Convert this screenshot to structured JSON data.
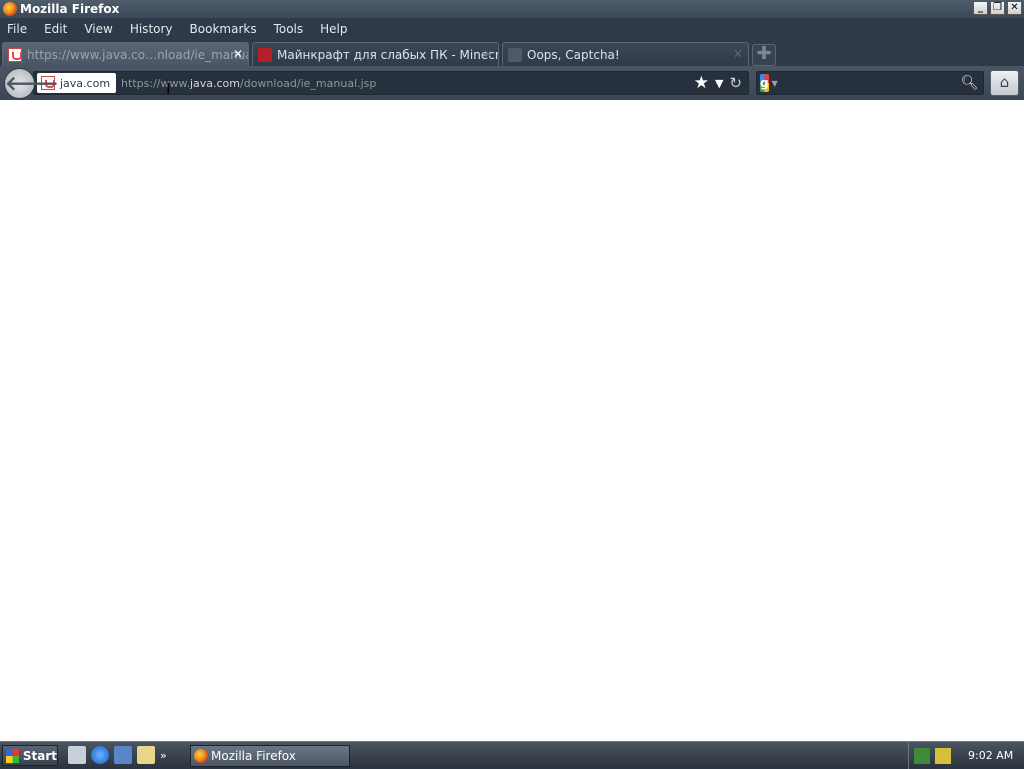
{
  "window": {
    "title": "Mozilla Firefox",
    "controls": {
      "minimize": "_",
      "restore": "❐",
      "close": "✕"
    }
  },
  "menubar": {
    "items": [
      {
        "label": "File"
      },
      {
        "label": "Edit"
      },
      {
        "label": "View"
      },
      {
        "label": "History"
      },
      {
        "label": "Bookmarks"
      },
      {
        "label": "Tools"
      },
      {
        "label": "Help"
      }
    ]
  },
  "tabs": [
    {
      "title": "https://www.java.co…nload/ie_manual.jsp",
      "icon": "java-icon",
      "active": true
    },
    {
      "title": "Майнкрафт для слабых ПК - Minecraft …",
      "icon": "minecraft-icon",
      "active": false
    },
    {
      "title": "Oops, Captcha!",
      "icon": "blank-page-icon",
      "active": false
    }
  ],
  "tab_close": "✕",
  "newtab_symbol": "✚",
  "navbar": {
    "identity_label": "java.com",
    "url_prefix": "https://www.",
    "url_host": "java.com",
    "url_path": "/download/ie_manual.jsp",
    "search_placeholder": "",
    "search_engine_letter": "g"
  },
  "taskbar": {
    "start_label": "Start",
    "task_label": "Mozilla Firefox",
    "more_symbol": "»",
    "clock": "9:02 AM"
  },
  "colors": {
    "chrome_dark": "#2e3a48",
    "content_bg": "#ffffff"
  }
}
